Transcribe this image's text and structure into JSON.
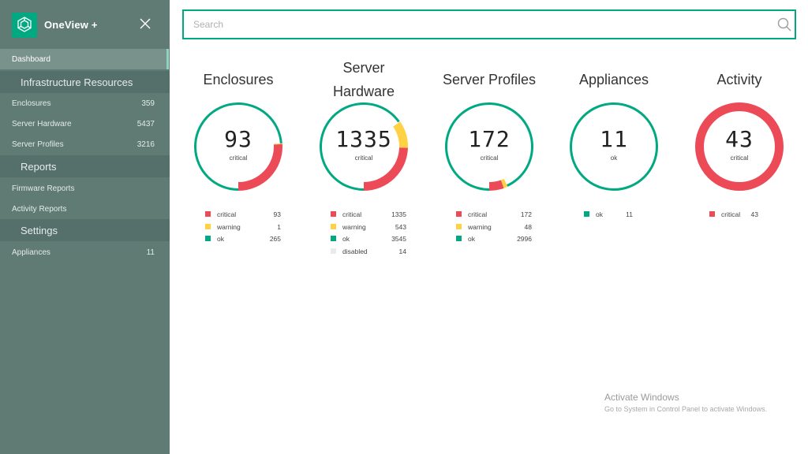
{
  "app": {
    "title": "OneView +",
    "accent_color": "#01a982",
    "sidebar_color": "#5f7b74"
  },
  "sidebar": {
    "dashboard": "Dashboard",
    "sections": [
      {
        "title": "Infrastructure Resources",
        "items": [
          {
            "label": "Enclosures",
            "count": "359"
          },
          {
            "label": "Server Hardware",
            "count": "5437"
          },
          {
            "label": "Server Profiles",
            "count": "3216"
          }
        ]
      },
      {
        "title": "Reports",
        "items": [
          {
            "label": "Firmware Reports",
            "count": ""
          },
          {
            "label": "Activity Reports",
            "count": ""
          }
        ]
      },
      {
        "title": "Settings",
        "items": [
          {
            "label": "Appliances",
            "count": "11"
          }
        ]
      }
    ]
  },
  "search": {
    "placeholder": "Search",
    "value": ""
  },
  "status_colors": {
    "critical": "#ec4a57",
    "warning": "#ffd144",
    "ok": "#01a982",
    "disabled": "#e8eaec"
  },
  "cards": [
    {
      "title_lines": [
        "Enclosures"
      ],
      "value": "93",
      "status": "critical",
      "legend": [
        {
          "name": "critical",
          "value": 93
        },
        {
          "name": "warning",
          "value": 1
        },
        {
          "name": "ok",
          "value": 265
        }
      ]
    },
    {
      "title_lines": [
        "Server",
        "Hardware"
      ],
      "value": "1335",
      "status": "critical",
      "legend": [
        {
          "name": "critical",
          "value": 1335
        },
        {
          "name": "warning",
          "value": 543
        },
        {
          "name": "ok",
          "value": 3545
        },
        {
          "name": "disabled",
          "value": 14
        }
      ]
    },
    {
      "title_lines": [
        "Server Profiles"
      ],
      "value": "172",
      "status": "critical",
      "legend": [
        {
          "name": "critical",
          "value": 172
        },
        {
          "name": "warning",
          "value": 48
        },
        {
          "name": "ok",
          "value": 2996
        }
      ]
    },
    {
      "title_lines": [
        "Appliances"
      ],
      "value": "11",
      "status": "ok",
      "legend": [
        {
          "name": "ok",
          "value": 11
        }
      ]
    },
    {
      "title_lines": [
        "Activity"
      ],
      "value": "43",
      "status": "critical",
      "legend": [
        {
          "name": "critical",
          "value": 43
        }
      ]
    }
  ],
  "watermark": {
    "title": "Activate Windows",
    "subtitle": "Go to System in Control Panel to activate Windows."
  }
}
